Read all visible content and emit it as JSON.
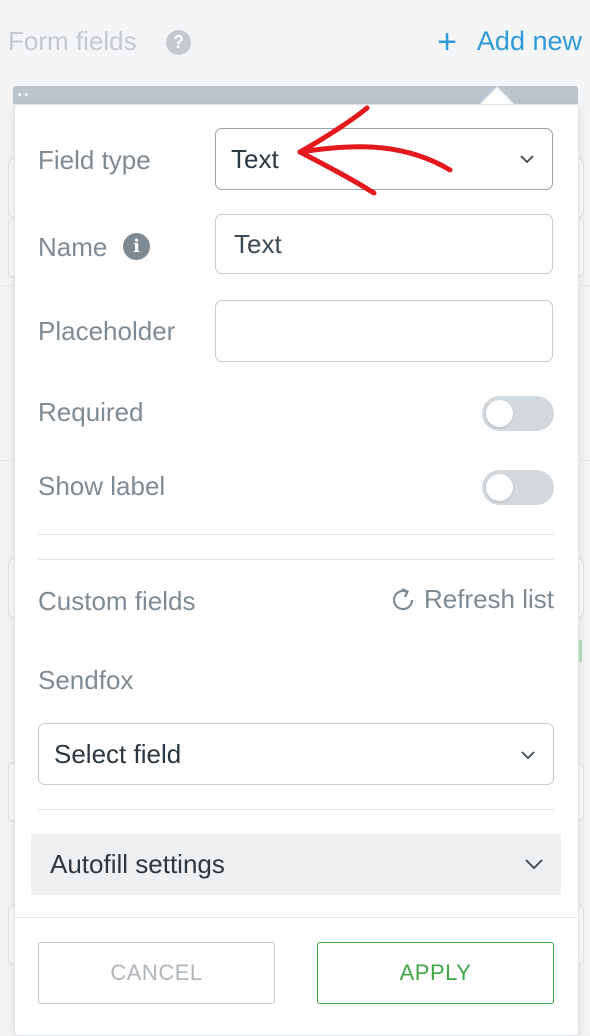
{
  "header": {
    "title": "Form fields",
    "help_icon": "?",
    "add_new_plus": "+",
    "add_new_label": "Add new"
  },
  "popup": {
    "field_type": {
      "label": "Field type",
      "value": "Text"
    },
    "name": {
      "label": "Name",
      "value": "Text",
      "info_icon": "i"
    },
    "placeholder": {
      "label": "Placeholder",
      "value": ""
    },
    "required": {
      "label": "Required",
      "on": false
    },
    "show_label": {
      "label": "Show label",
      "on": false
    },
    "custom_fields": {
      "label": "Custom fields",
      "refresh_label": "Refresh list"
    },
    "sendfox": {
      "label": "Sendfox",
      "select_value": "Select field"
    },
    "autofill": {
      "label": "Autofill settings"
    },
    "buttons": {
      "cancel": "CANCEL",
      "apply": "APPLY"
    }
  },
  "colors": {
    "accent_blue": "#2f9ad6",
    "apply_green": "#3fa648",
    "annotation_red": "#e3191d",
    "label_gray": "#7f8a92"
  },
  "icons": [
    "help-icon",
    "plus-icon",
    "info-icon",
    "chevron-down-icon",
    "refresh-icon",
    "red-arrow-annotation"
  ]
}
